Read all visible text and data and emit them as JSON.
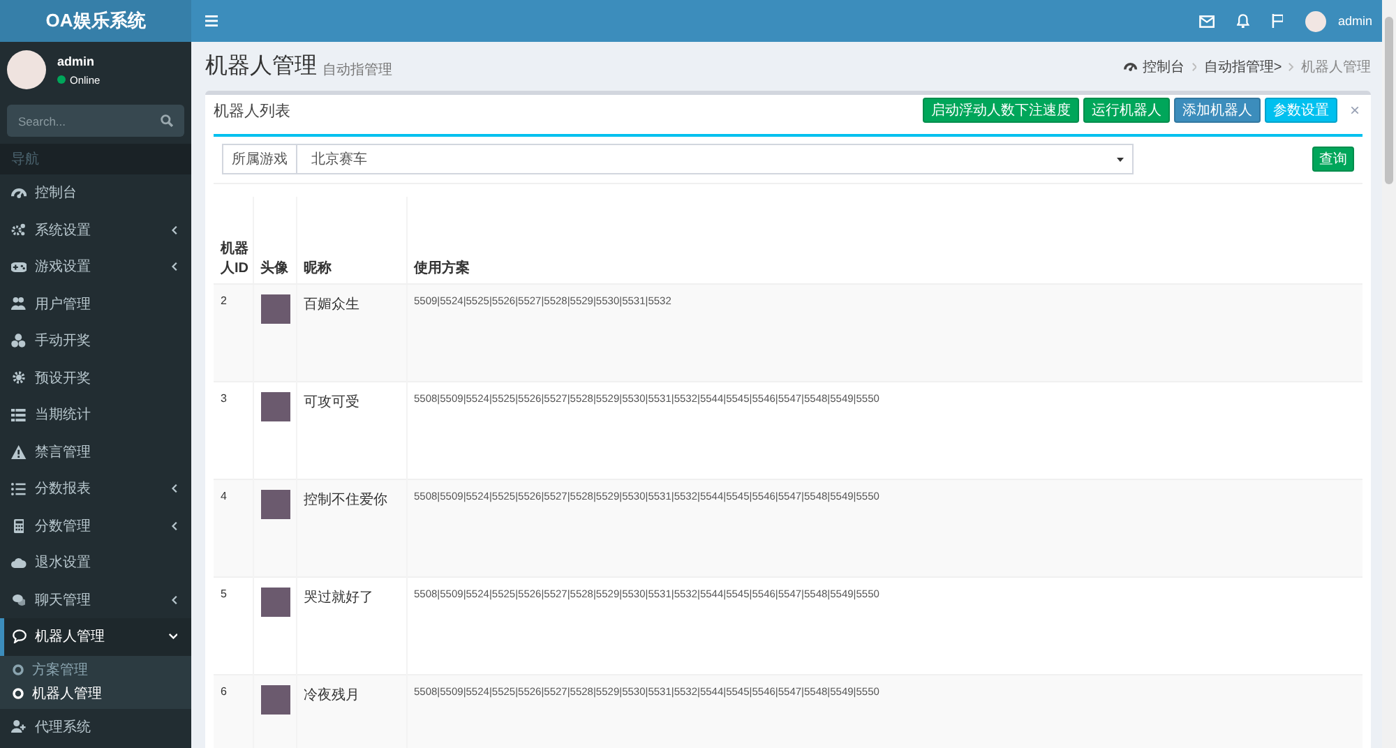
{
  "sidebar": {
    "brand": "OA娱乐系统",
    "user": {
      "name": "admin",
      "status": "Online",
      "online": true
    },
    "search": {
      "placeholder": "Search..."
    },
    "nav_header": "导航",
    "menu": [
      {
        "label": "控制台",
        "kind": "link",
        "selected": false,
        "expanded": false
      },
      {
        "label": "系统设置",
        "kind": "submenu",
        "selected": false,
        "expanded": false
      },
      {
        "label": "游戏设置",
        "kind": "submenu",
        "selected": false,
        "expanded": false
      },
      {
        "label": "用户管理",
        "kind": "link",
        "selected": false,
        "expanded": false
      },
      {
        "label": "手动开奖",
        "kind": "link",
        "selected": false,
        "expanded": false
      },
      {
        "label": "预设开奖",
        "kind": "link",
        "selected": false,
        "expanded": false
      },
      {
        "label": "当期统计",
        "kind": "link",
        "selected": false,
        "expanded": false
      },
      {
        "label": "禁言管理",
        "kind": "link",
        "selected": false,
        "expanded": false
      },
      {
        "label": "分数报表",
        "kind": "submenu",
        "selected": false,
        "expanded": false
      },
      {
        "label": "分数管理",
        "kind": "submenu",
        "selected": false,
        "expanded": false
      },
      {
        "label": "退水设置",
        "kind": "link",
        "selected": false,
        "expanded": false
      },
      {
        "label": "聊天管理",
        "kind": "submenu",
        "selected": false,
        "expanded": false
      },
      {
        "label": "机器人管理",
        "kind": "submenu",
        "selected": true,
        "expanded": true,
        "children": [
          {
            "label": "方案管理",
            "selected": false
          },
          {
            "label": "机器人管理",
            "selected": true
          }
        ]
      },
      {
        "label": "代理系统",
        "kind": "link",
        "selected": false,
        "expanded": false
      }
    ]
  },
  "navbar": {
    "user_name": "admin"
  },
  "content_header": {
    "title": "机器人管理",
    "subtitle": "自动指管理",
    "breadcrumb": [
      "控制台",
      "自动指管理>",
      "机器人管理"
    ]
  },
  "box": {
    "title": "机器人列表",
    "buttons": [
      {
        "label": "启动浮动人数下注速度",
        "color": "#00a65a"
      },
      {
        "label": "运行机器人",
        "color": "#00a65a"
      },
      {
        "label": "添加机器人",
        "color": "#3c8dbc"
      },
      {
        "label": "参数设置",
        "color": "#00c0ef"
      }
    ],
    "close": "×",
    "filter": {
      "label": "所属游戏",
      "value": "北京赛车",
      "button": "查询"
    },
    "table": {
      "columns": [
        "机器人ID",
        "头像",
        "昵称",
        "使用方案"
      ],
      "rows": [
        {
          "id": "2",
          "nickname": "百媚众生",
          "plan": "5509|5524|5525|5526|5527|5528|5529|5530|5531|5532"
        },
        {
          "id": "3",
          "nickname": "可攻可受",
          "plan": "5508|5509|5524|5525|5526|5527|5528|5529|5530|5531|5532|5544|5545|5546|5547|5548|5549|5550"
        },
        {
          "id": "4",
          "nickname": "控制不住爱你",
          "plan": "5508|5509|5524|5525|5526|5527|5528|5529|5530|5531|5532|5544|5545|5546|5547|5548|5549|5550"
        },
        {
          "id": "5",
          "nickname": "哭过就好了",
          "plan": "5508|5509|5524|5525|5526|5527|5528|5529|5530|5531|5532|5544|5545|5546|5547|5548|5549|5550"
        },
        {
          "id": "6",
          "nickname": "冷夜残月",
          "plan": "5508|5509|5524|5525|5526|5527|5528|5529|5530|5531|5532|5544|5545|5546|5547|5548|5549|5550"
        }
      ]
    }
  }
}
